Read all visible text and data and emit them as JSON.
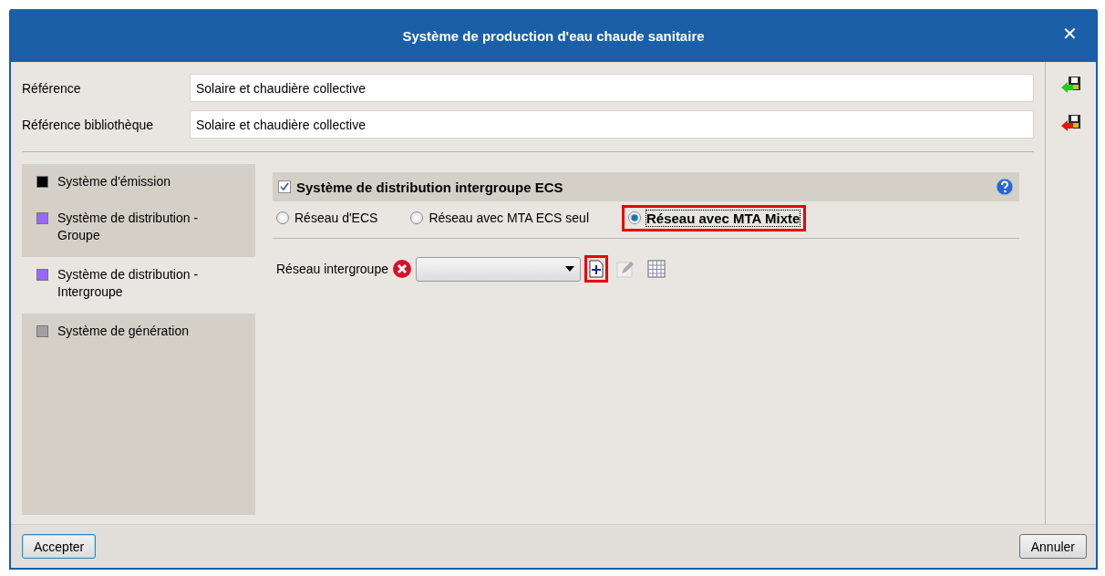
{
  "window": {
    "title": "Système de production d'eau chaude sanitaire",
    "close": "✕"
  },
  "fields": [
    {
      "label": "Référence",
      "value": "Solaire et chaudière collective"
    },
    {
      "label": "Référence bibliothèque",
      "value": "Solaire et chaudière collective"
    }
  ],
  "sidebar": {
    "items": [
      {
        "label": "Système d'émission",
        "color": "#000000",
        "selected": false
      },
      {
        "label": "Système de distribution - Groupe",
        "color": "#9966ff",
        "selected": false
      },
      {
        "label": "Système de distribution - Intergroupe",
        "color": "#9966ff",
        "selected": true
      },
      {
        "label": "Système de génération",
        "color": "#a0a0a0",
        "selected": false
      }
    ]
  },
  "group": {
    "title": "Système de distribution intergroupe ECS",
    "checked": true,
    "options": [
      {
        "label": "Réseau d'ECS",
        "selected": false,
        "highlighted": false
      },
      {
        "label": "Réseau avec MTA ECS seul",
        "selected": false,
        "highlighted": false
      },
      {
        "label": "Réseau avec MTA Mixte",
        "selected": true,
        "highlighted": true
      }
    ]
  },
  "network": {
    "label": "Réseau intergroupe",
    "error": true,
    "new_highlighted": true
  },
  "buttons": {
    "accept": "Accepter",
    "cancel": "Annuler"
  }
}
